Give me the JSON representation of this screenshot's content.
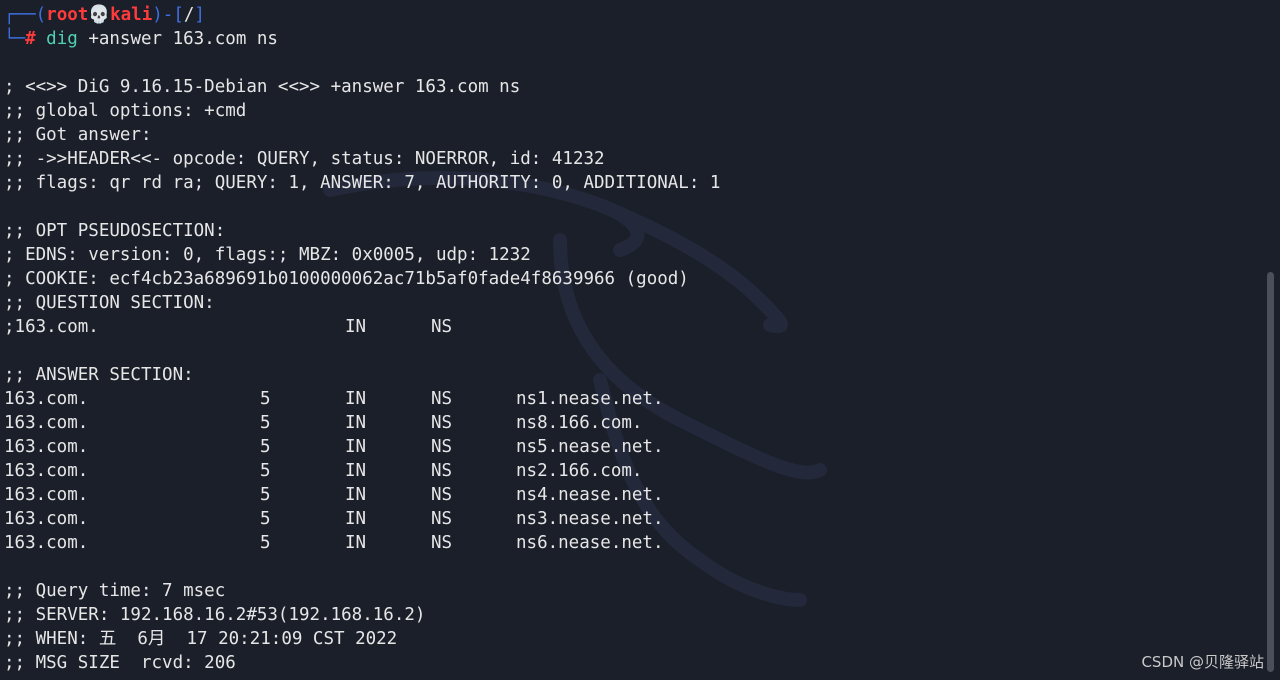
{
  "prompt": {
    "open_bracket": "┌──(",
    "user": "root",
    "skull": "💀",
    "host": "kali",
    "sep": ")-[",
    "path": "/",
    "close_bracket": "]",
    "corner": "└─",
    "symbol": "#",
    "command_word": "dig",
    "command_args": " +answer 163.com ns"
  },
  "header_lines": [
    "; <<>> DiG 9.16.15-Debian <<>> +answer 163.com ns",
    ";; global options: +cmd",
    ";; Got answer:",
    ";; ->>HEADER<<- opcode: QUERY, status: NOERROR, id: 41232",
    ";; flags: qr rd ra; QUERY: 1, ANSWER: 7, AUTHORITY: 0, ADDITIONAL: 1"
  ],
  "opt_lines": [
    ";; OPT PSEUDOSECTION:",
    "; EDNS: version: 0, flags:; MBZ: 0x0005, udp: 1232",
    "; COOKIE: ecf4cb23a689691b0100000062ac71b5af0fade4f8639966 (good)",
    ";; QUESTION SECTION:"
  ],
  "question": {
    "name": ";163.com.",
    "class": "IN",
    "type": "NS"
  },
  "answer_heading": ";; ANSWER SECTION:",
  "answers": [
    {
      "name": "163.com.",
      "ttl": "5",
      "class": "IN",
      "type": "NS",
      "data": "ns1.nease.net."
    },
    {
      "name": "163.com.",
      "ttl": "5",
      "class": "IN",
      "type": "NS",
      "data": "ns8.166.com."
    },
    {
      "name": "163.com.",
      "ttl": "5",
      "class": "IN",
      "type": "NS",
      "data": "ns5.nease.net."
    },
    {
      "name": "163.com.",
      "ttl": "5",
      "class": "IN",
      "type": "NS",
      "data": "ns2.166.com."
    },
    {
      "name": "163.com.",
      "ttl": "5",
      "class": "IN",
      "type": "NS",
      "data": "ns4.nease.net."
    },
    {
      "name": "163.com.",
      "ttl": "5",
      "class": "IN",
      "type": "NS",
      "data": "ns3.nease.net."
    },
    {
      "name": "163.com.",
      "ttl": "5",
      "class": "IN",
      "type": "NS",
      "data": "ns6.nease.net."
    }
  ],
  "footer_lines": [
    ";; Query time: 7 msec",
    ";; SERVER: 192.168.16.2#53(192.168.16.2)",
    ";; WHEN: 五  6月  17 20:21:09 CST 2022",
    ";; MSG SIZE  rcvd: 206"
  ],
  "watermark": "CSDN @贝隆驿站",
  "colors": {
    "background": "#1b1f2a",
    "text": "#e6e6e6",
    "prompt_blue": "#3d6fe0",
    "root_red": "#ff3b3b",
    "command_teal": "#4fd1b5"
  }
}
